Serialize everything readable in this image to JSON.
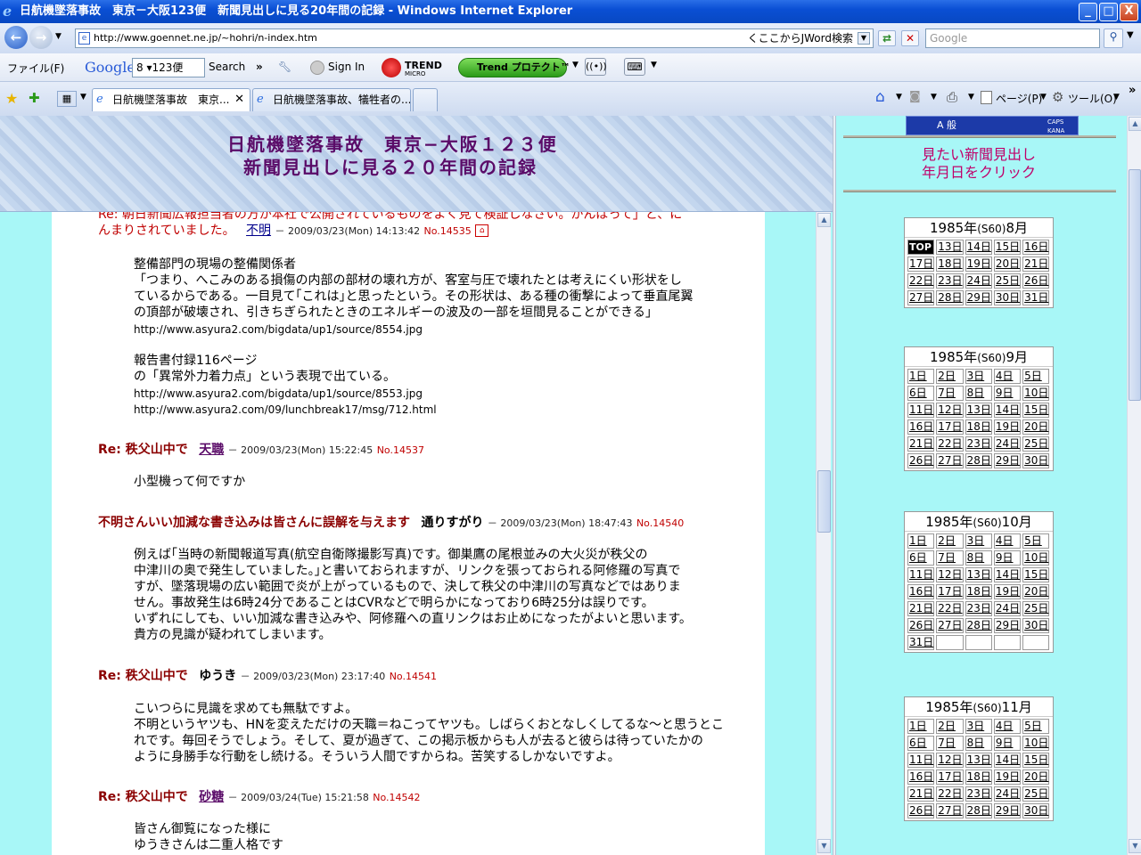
{
  "window": {
    "title": "日航機墜落事故　東京－大阪123便　新聞見出しに見る20年間の記録 - Windows Internet Explorer",
    "min_label": "_",
    "max_label": "□",
    "close_label": "X"
  },
  "address_bar": {
    "url": "http://www.goennet.ne.jp/~hohri/n-index.htm",
    "jword_label": "くここからJWord検索",
    "search_placeholder": "Google"
  },
  "toolbar": {
    "file_menu": "ファイル(F)",
    "google_logo": "Google",
    "google_select_value": "8 ▾123便",
    "search_label": "Search",
    "sign_in": "Sign In",
    "trend_label": "TREND",
    "trend_sub": "MICRO",
    "trend_protect": "Trend プロテクト™"
  },
  "tabs": [
    {
      "label": "日航機墜落事故　東京..."
    },
    {
      "label": "日航機墜落事故、犠牲者の..."
    }
  ],
  "command_bar": {
    "page_label": "ページ(P)",
    "tools_label": "ツール(O)"
  },
  "banner": {
    "line1": "日航機墜落事故　東京−大阪１２３便",
    "line2": "新聞見出しに見る２０年間の記録"
  },
  "posts": {
    "p1_cut": "Re: 朝日新聞広報担当者の方が本社で公開されているものをよく見て検証しなさい。がんばって」と、に",
    "p1_cont": "んまりされていました。",
    "p1_author": "不明",
    "p1_meta": "－ 2009/03/23(Mon) 14:13:42",
    "p1_no": "No.14535",
    "p1_body": [
      "整備部門の現場の整備関係者",
      "「つまり、へこみのある損傷の内部の部材の壊れ方が、客室与圧で壊れたとは考えにくい形状をし",
      "ているからである。一目見て｢これは｣と思ったという。その形状は、ある種の衝撃によって垂直尾翼",
      "の頂部が破壊され、引きちぎられたときのエネルギーの波及の一部を垣間見ることができる」"
    ],
    "p1_link1": "http://www.asyura2.com/bigdata/up1/source/8554.jpg",
    "p1_body2": [
      "報告書付録116ページ",
      "の「異常外力着力点」という表現で出ている。"
    ],
    "p1_link2": "http://www.asyura2.com/bigdata/up1/source/8553.jpg",
    "p1_link3": "http://www.asyura2.com/09/lunchbreak17/msg/712.html",
    "p2_title": "Re: 秩父山中で",
    "p2_author": "天職",
    "p2_meta": "－ 2009/03/23(Mon) 15:22:45",
    "p2_no": "No.14537",
    "p2_body": "小型機って何ですか",
    "p3_title": "不明さんいい加減な書き込みは皆さんに誤解を与えます",
    "p3_author": "通りすがり",
    "p3_meta": "－ 2009/03/23(Mon) 18:47:43",
    "p3_no": "No.14540",
    "p3_body": [
      "例えば｢当時の新聞報道写真(航空自衛隊撮影写真)です。御巣鷹の尾根並みの大火災が秩父の",
      "中津川の奥で発生していました。｣と書いておられますが、リンクを張っておられる阿修羅の写真で",
      "すが、墜落現場の広い範囲で炎が上がっているもので、決して秩父の中津川の写真などではありま",
      "せん。事故発生は6時24分であることはCVRなどで明らかになっており6時25分は誤りです。",
      "いずれにしても、いい加減な書き込みや、阿修羅への直リンクはお止めになったがよいと思います。",
      "貴方の見識が疑われてしまいます。"
    ],
    "p4_title": "Re: 秩父山中で",
    "p4_author": "ゆうき",
    "p4_meta": "－ 2009/03/23(Mon) 23:17:40",
    "p4_no": "No.14541",
    "p4_body": [
      "こいつらに見識を求めても無駄ですよ。",
      "不明というヤツも、HNを変えただけの天職＝ねこってヤツも。しばらくおとなしくしてるな～と思うとこ",
      "れです。毎回そうでしょう。そして、夏が過ぎて、この掲示板からも人が去ると彼らは待っていたかの",
      "ように身勝手な行動をし続ける。そういう人間ですからね。苦笑するしかないですよ。"
    ],
    "p5_title": "Re: 秩父山中で",
    "p5_author": "砂糖",
    "p5_meta": "－ 2009/03/24(Tue) 15:21:58",
    "p5_no": "No.14542",
    "p5_body": [
      "皆さん御覧になった様に",
      "ゆうきさんは二重人格です"
    ]
  },
  "sidebar": {
    "ime_label": "A 般",
    "caps_label": "CAPS",
    "kana_label": "KANA",
    "prompt_line1": "見たい新聞見出し",
    "prompt_line2": "年月日をクリック",
    "calendars": [
      {
        "year": "1985年",
        "era": "(S60)",
        "month": "8月",
        "rows": [
          [
            "TOP",
            "13日",
            "14日",
            "15日",
            "16日"
          ],
          [
            "17日",
            "18日",
            "19日",
            "20日",
            "21日"
          ],
          [
            "22日",
            "23日",
            "24日",
            "25日",
            "26日"
          ],
          [
            "27日",
            "28日",
            "29日",
            "30日",
            "31日"
          ]
        ]
      },
      {
        "year": "1985年",
        "era": "(S60)",
        "month": "9月",
        "rows": [
          [
            "1日",
            "2日",
            "3日",
            "4日",
            "5日"
          ],
          [
            "6日",
            "7日",
            "8日",
            "9日",
            "10日"
          ],
          [
            "11日",
            "12日",
            "13日",
            "14日",
            "15日"
          ],
          [
            "16日",
            "17日",
            "18日",
            "19日",
            "20日"
          ],
          [
            "21日",
            "22日",
            "23日",
            "24日",
            "25日"
          ],
          [
            "26日",
            "27日",
            "28日",
            "29日",
            "30日"
          ]
        ]
      },
      {
        "year": "1985年",
        "era": "(S60)",
        "month": "10月",
        "rows": [
          [
            "1日",
            "2日",
            "3日",
            "4日",
            "5日"
          ],
          [
            "6日",
            "7日",
            "8日",
            "9日",
            "10日"
          ],
          [
            "11日",
            "12日",
            "13日",
            "14日",
            "15日"
          ],
          [
            "16日",
            "17日",
            "18日",
            "19日",
            "20日"
          ],
          [
            "21日",
            "22日",
            "23日",
            "24日",
            "25日"
          ],
          [
            "26日",
            "27日",
            "28日",
            "29日",
            "30日"
          ],
          [
            "31日",
            "",
            "",
            "",
            ""
          ]
        ]
      },
      {
        "year": "1985年",
        "era": "(S60)",
        "month": "11月",
        "rows": [
          [
            "1日",
            "2日",
            "3日",
            "4日",
            "5日"
          ],
          [
            "6日",
            "7日",
            "8日",
            "9日",
            "10日"
          ],
          [
            "11日",
            "12日",
            "13日",
            "14日",
            "15日"
          ],
          [
            "16日",
            "17日",
            "18日",
            "19日",
            "20日"
          ],
          [
            "21日",
            "22日",
            "23日",
            "24日",
            "25日"
          ],
          [
            "26日",
            "27日",
            "28日",
            "29日",
            "30日"
          ]
        ]
      }
    ]
  }
}
